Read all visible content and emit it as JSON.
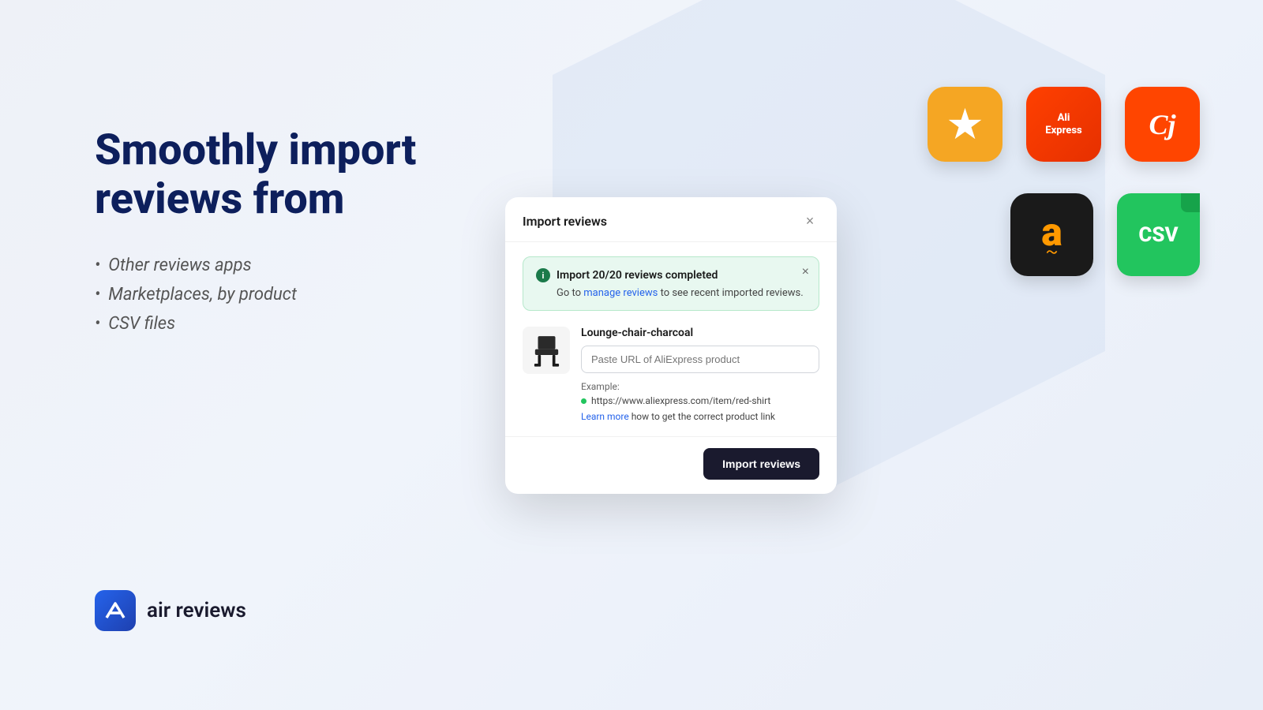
{
  "page": {
    "background": "#eef1f7"
  },
  "left": {
    "headline": "Smoothly import reviews from",
    "bullets": [
      "Other reviews apps",
      "Marketplaces, by product",
      "CSV files"
    ]
  },
  "logo": {
    "text": "air reviews",
    "icon_letter": "A"
  },
  "icons": {
    "top_row": [
      {
        "name": "trustpilot",
        "label": "★",
        "bg": "#f5a623"
      },
      {
        "name": "aliexpress",
        "label": "AliExpress",
        "bg": "#ff4000"
      },
      {
        "name": "cursive-app",
        "label": "Cj",
        "bg": "#ff4500"
      }
    ],
    "bottom_row": [
      {
        "name": "amazon",
        "label": "a",
        "bg": "#1a1a1a"
      },
      {
        "name": "csv",
        "label": "CSV",
        "bg": "#22c55e"
      }
    ]
  },
  "dialog": {
    "title": "Import reviews",
    "close_label": "×",
    "success_banner": {
      "title": "Import 20/20 reviews completed",
      "body_prefix": "Go to ",
      "link_text": "manage reviews",
      "body_suffix": " to see recent imported reviews.",
      "close_label": "×"
    },
    "product": {
      "name": "Lounge-chair-charcoal",
      "input_placeholder": "Paste URL of AliExpress product",
      "example_label": "Example:",
      "example_url": "https://www.aliexpress.com/item/red-shirt",
      "learn_more_prefix": "",
      "learn_more_link_text": "Learn more",
      "learn_more_suffix": " how to get the correct product link"
    },
    "footer": {
      "import_button_label": "Import reviews"
    }
  }
}
